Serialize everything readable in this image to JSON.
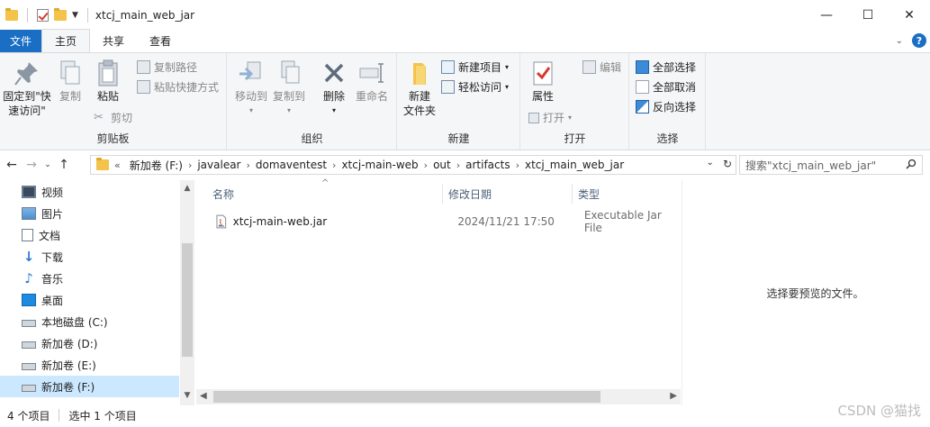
{
  "window": {
    "title": "xtcj_main_web_jar",
    "minimize": "—",
    "maximize": "☐",
    "close": "✕"
  },
  "tabs": {
    "file": "文件",
    "home": "主页",
    "share": "共享",
    "view": "查看"
  },
  "ribbon": {
    "clipboard": {
      "label": "剪贴板",
      "pin_line1": "固定到\"快",
      "pin_line2": "速访问\"",
      "copy": "复制",
      "paste": "粘贴",
      "copy_path": "复制路径",
      "paste_shortcut": "粘贴快捷方式",
      "cut": "剪切"
    },
    "organize": {
      "label": "组织",
      "move_to": "移动到",
      "copy_to": "复制到",
      "delete": "删除",
      "rename": "重命名"
    },
    "new": {
      "label": "新建",
      "new_folder_line1": "新建",
      "new_folder_line2": "文件夹",
      "new_item": "新建项目",
      "easy_access": "轻松访问"
    },
    "open": {
      "label": "打开",
      "properties": "属性",
      "open": "打开",
      "edit": "编辑"
    },
    "select": {
      "label": "选择",
      "select_all": "全部选择",
      "select_none": "全部取消",
      "invert": "反向选择"
    }
  },
  "address": {
    "overflow": "«",
    "crumbs": [
      "新加卷 (F:)",
      "javalear",
      "domaventest",
      "xtcj-main-web",
      "out",
      "artifacts",
      "xtcj_main_web_jar"
    ],
    "search_placeholder": "搜索\"xtcj_main_web_jar\""
  },
  "nav": {
    "items": [
      "视频",
      "图片",
      "文档",
      "下载",
      "音乐",
      "桌面",
      "本地磁盘 (C:)",
      "新加卷 (D:)",
      "新加卷 (E:)",
      "新加卷 (F:)"
    ]
  },
  "columns": {
    "name": "名称",
    "date": "修改日期",
    "type": "类型"
  },
  "files": [
    {
      "name": "xtcj-main-web.jar",
      "date": "2024/11/21 17:50",
      "type": "Executable Jar File"
    }
  ],
  "preview": {
    "empty": "选择要预览的文件。"
  },
  "status": {
    "count": "4 个项目",
    "selected": "选中 1 个项目"
  },
  "watermark": "CSDN @猫找"
}
